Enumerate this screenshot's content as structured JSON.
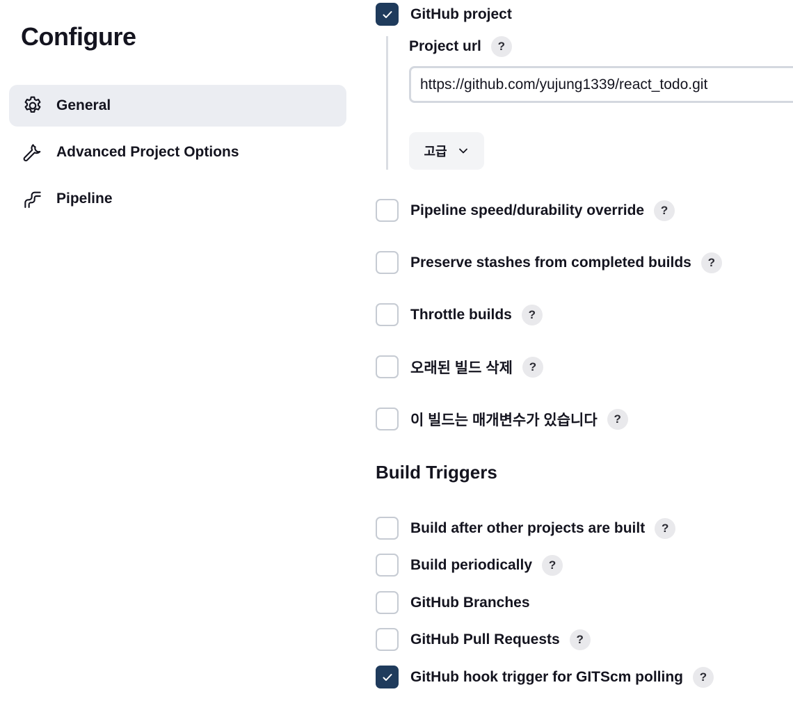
{
  "page": {
    "title": "Configure"
  },
  "sidebar": {
    "items": [
      {
        "label": "General",
        "icon": "gear-icon",
        "active": true
      },
      {
        "label": "Advanced Project Options",
        "icon": "wrench-icon",
        "active": false
      },
      {
        "label": "Pipeline",
        "icon": "pipeline-icon",
        "active": false
      }
    ]
  },
  "general": {
    "github_project": {
      "label": "GitHub project",
      "checked": true
    },
    "project_url": {
      "label": "Project url",
      "help": "?",
      "value": "https://github.com/yujung1339/react_todo.git"
    },
    "advanced_button": {
      "label": "고급",
      "icon": "chevron-down-icon"
    },
    "options": [
      {
        "label": "Pipeline speed/durability override",
        "help": "?",
        "checked": false
      },
      {
        "label": "Preserve stashes from completed builds",
        "help": "?",
        "checked": false
      },
      {
        "label": "Throttle builds",
        "help": "?",
        "checked": false
      },
      {
        "label": "오래된 빌드 삭제",
        "help": "?",
        "checked": false
      },
      {
        "label": "이 빌드는 매개변수가 있습니다",
        "help": "?",
        "checked": false
      }
    ]
  },
  "build_triggers": {
    "title": "Build Triggers",
    "options": [
      {
        "label": "Build after other projects are built",
        "help": "?",
        "checked": false
      },
      {
        "label": "Build periodically",
        "help": "?",
        "checked": false
      },
      {
        "label": "GitHub Branches",
        "checked": false
      },
      {
        "label": "GitHub Pull Requests",
        "help": "?",
        "checked": false
      },
      {
        "label": "GitHub hook trigger for GITScm polling",
        "help": "?",
        "checked": true
      }
    ]
  },
  "colors": {
    "checkbox_checked": "#1f3b5c",
    "nav_active_bg": "#ebedf2",
    "help_bg": "#e9e9ec"
  }
}
